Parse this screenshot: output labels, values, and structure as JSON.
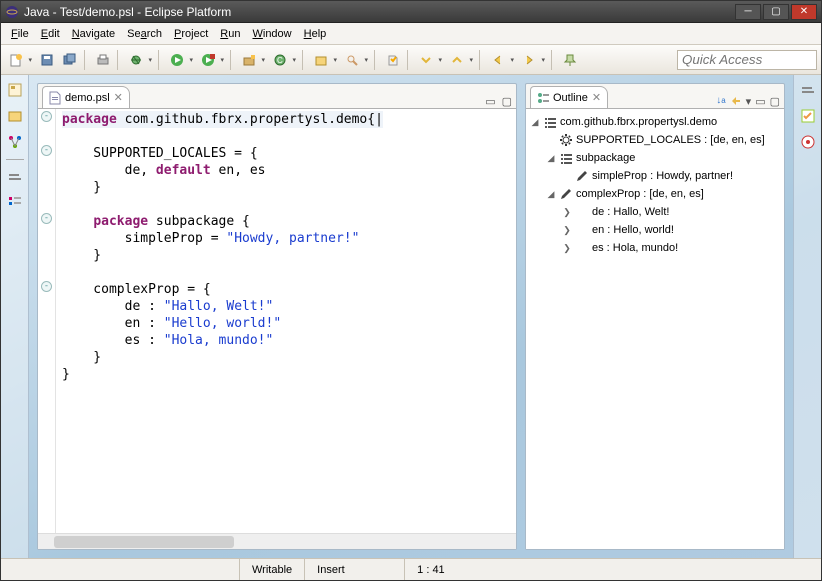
{
  "window": {
    "title": "Java - Test/demo.psl - Eclipse Platform"
  },
  "menu": {
    "file": "File",
    "edit": "Edit",
    "navigate": "Navigate",
    "search": "Search",
    "project": "Project",
    "run": "Run",
    "window": "Window",
    "help": "Help"
  },
  "toolbar": {
    "quick_access_placeholder": "Quick Access"
  },
  "editor": {
    "tab": {
      "label": "demo.psl"
    },
    "code_lines": [
      {
        "kind": "pkg",
        "t1": "package",
        "t2": " com.github.fbrx.propertysl.demo{"
      },
      {
        "kind": "blank"
      },
      {
        "kind": "plain",
        "indent": 1,
        "text": "SUPPORTED_LOCALES = {"
      },
      {
        "kind": "def",
        "indent": 2,
        "pre": "de, ",
        "kw": "default",
        "post": " en, es"
      },
      {
        "kind": "plain",
        "indent": 1,
        "text": "}"
      },
      {
        "kind": "blank"
      },
      {
        "kind": "subpkg",
        "indent": 1,
        "kw": "package",
        "name": " subpackage {"
      },
      {
        "kind": "prop",
        "indent": 2,
        "key": "simpleProp = ",
        "val": "\"Howdy, partner!\""
      },
      {
        "kind": "plain",
        "indent": 1,
        "text": "}"
      },
      {
        "kind": "blank"
      },
      {
        "kind": "plain",
        "indent": 1,
        "text": "complexProp = {"
      },
      {
        "kind": "prop",
        "indent": 2,
        "key": "de : ",
        "val": "\"Hallo, Welt!\""
      },
      {
        "kind": "prop",
        "indent": 2,
        "key": "en : ",
        "val": "\"Hello, world!\""
      },
      {
        "kind": "prop",
        "indent": 2,
        "key": "es : ",
        "val": "\"Hola, mundo!\""
      },
      {
        "kind": "plain",
        "indent": 1,
        "text": "}"
      },
      {
        "kind": "plain",
        "indent": 0,
        "text": "}"
      }
    ]
  },
  "outline": {
    "title": "Outline",
    "items": [
      {
        "depth": 0,
        "tw": "◢",
        "icon": "list",
        "label": "com.github.fbrx.propertysl.demo"
      },
      {
        "depth": 1,
        "tw": "",
        "icon": "gear",
        "label": "SUPPORTED_LOCALES : [de, en, es]"
      },
      {
        "depth": 1,
        "tw": "◢",
        "icon": "list",
        "label": "subpackage"
      },
      {
        "depth": 2,
        "tw": "",
        "icon": "pencil",
        "label": "simpleProp : Howdy, partner!"
      },
      {
        "depth": 1,
        "tw": "◢",
        "icon": "pencil",
        "label": "complexProp : [de, en, es]"
      },
      {
        "depth": 2,
        "tw": "❯",
        "icon": "none",
        "label": "de : Hallo, Welt!"
      },
      {
        "depth": 2,
        "tw": "❯",
        "icon": "none",
        "label": "en : Hello, world!"
      },
      {
        "depth": 2,
        "tw": "❯",
        "icon": "none",
        "label": "es : Hola, mundo!"
      }
    ]
  },
  "status": {
    "writable": "Writable",
    "insert": "Insert",
    "pos": "1 : 41"
  }
}
